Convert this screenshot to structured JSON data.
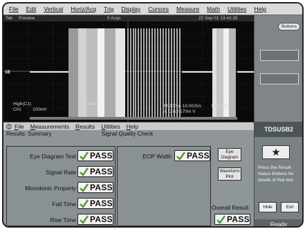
{
  "menubar": {
    "items": [
      "File",
      "Edit",
      "Vertical",
      "Horiz/Acq",
      "Trig",
      "Display",
      "Cursors",
      "Measure",
      "Math",
      "Utilities",
      "Help"
    ]
  },
  "scope": {
    "status": "Tek",
    "mode": "Preview",
    "acqs": "0 Acqs",
    "timestamp": "22 Sep 01 13:42:35",
    "marker": "1E",
    "ch_label_1": "High(C1)",
    "ch_label_2": "Ch1",
    "ch_scale": "100mV",
    "unstable": "Unstable",
    "timebase": "M 200ns 10.0GS/s",
    "pts": "100ps/pt",
    "trigger": "A  Ch1  /  170m  V"
  },
  "right_panel": {
    "buttons_label": "Buttons"
  },
  "app_menu": {
    "items": [
      {
        "underline": "F",
        "rest": "ile"
      },
      {
        "underline": "M",
        "rest": "easurements"
      },
      {
        "underline": "R",
        "rest": "esults"
      },
      {
        "underline": "U",
        "rest": "tilities"
      },
      {
        "underline": "H",
        "rest": "elp"
      }
    ]
  },
  "results_header": {
    "left": "Results: Summary",
    "center": "Signal Quality Check"
  },
  "tests": [
    {
      "label": "Eye Diagram Test",
      "result": "PASS"
    },
    {
      "label": "Signal Rate",
      "result": "PASS"
    },
    {
      "label": "Monotonic Property",
      "result": "PASS"
    },
    {
      "label": "Fall Time",
      "result": "PASS"
    },
    {
      "label": "Rise Time",
      "result": "PASS"
    }
  ],
  "eop": {
    "label": "EOP Width",
    "result": "PASS"
  },
  "eye_diagram_button": "Eye Diagram",
  "waveform_plot_button": "Waveform Plot",
  "overall": {
    "label": "Overall Result",
    "result": "PASS"
  },
  "side_panel": {
    "title": "TDSUSB2",
    "help_text": "Press the Result Status Buttons for details of that test.",
    "hide_label": "Hide",
    "exit_label": "Exit",
    "status": "Ready"
  },
  "colors": {
    "pass_check": "#5a9a3a",
    "scope_bg": "#0a0a0a",
    "panel_bg": "#8f9699"
  }
}
